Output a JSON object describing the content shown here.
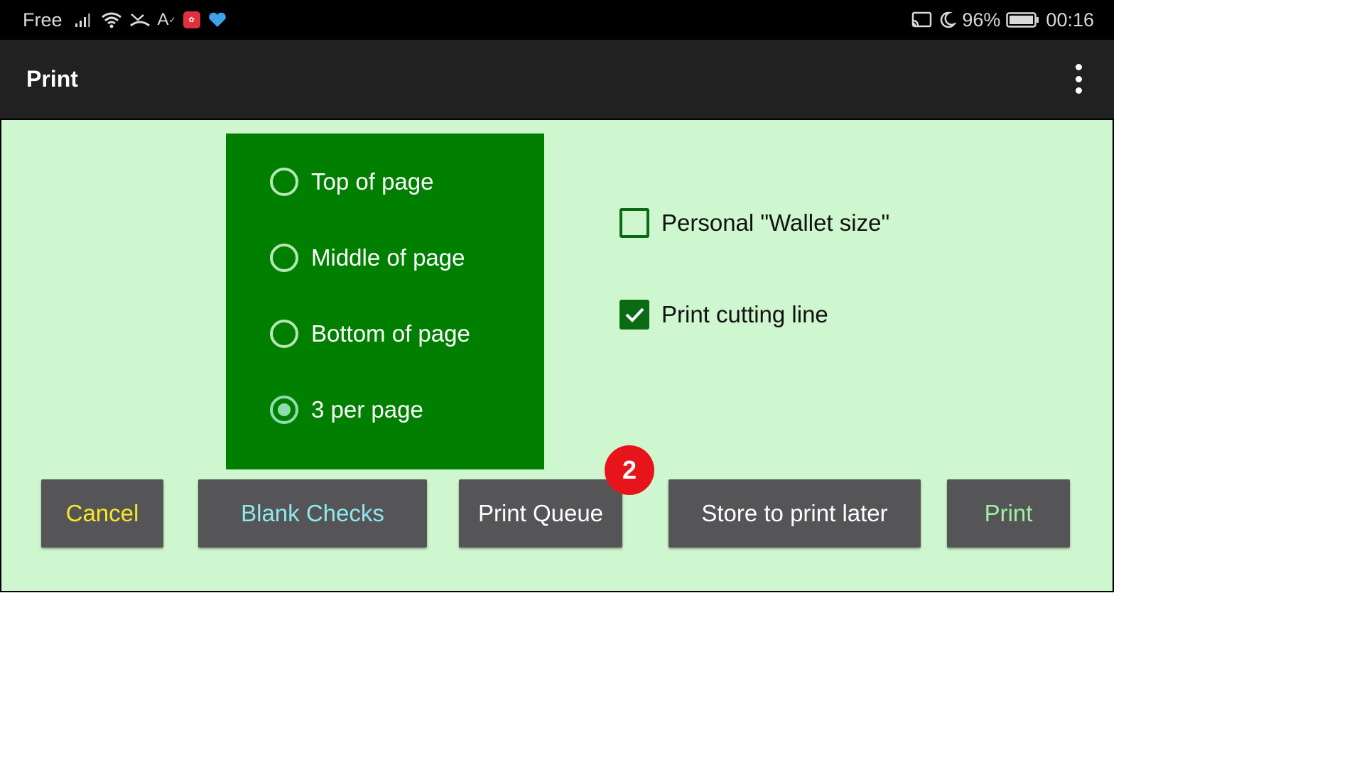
{
  "status_bar": {
    "carrier": "Free",
    "battery_percent": "96%",
    "time": "00:16",
    "icons_left": [
      "signal-icon",
      "wifi-icon",
      "missed-call-icon",
      "font-size-icon",
      "huawei-app-icon",
      "health-app-icon"
    ],
    "icons_right": [
      "cast-icon",
      "moon-icon",
      "battery-icon"
    ]
  },
  "app_bar": {
    "title": "Print",
    "menu_icon": "more-vert-icon"
  },
  "position_options": {
    "items": [
      {
        "label": "Top of page",
        "selected": false
      },
      {
        "label": "Middle of page",
        "selected": false
      },
      {
        "label": "Bottom of page",
        "selected": false
      },
      {
        "label": "3 per page",
        "selected": true
      }
    ]
  },
  "checkboxes": {
    "wallet": {
      "label": "Personal \"Wallet size\"",
      "checked": false
    },
    "cutting_line": {
      "label": "Print cutting line",
      "checked": true
    }
  },
  "buttons": {
    "cancel": {
      "label": "Cancel",
      "color": "#f5e82a"
    },
    "blank_checks": {
      "label": "Blank Checks",
      "color": "#8ee8ec"
    },
    "print_queue": {
      "label": "Print Queue",
      "color": "#ffffff",
      "badge": "2"
    },
    "store_later": {
      "label": "Store to print later",
      "color": "#ffffff"
    },
    "print": {
      "label": "Print",
      "color": "#9ff09f"
    }
  },
  "colors": {
    "background": "#cff7cf",
    "panel": "#007f00",
    "app_bar": "#212121",
    "button": "#555558",
    "badge": "#e8141b"
  }
}
